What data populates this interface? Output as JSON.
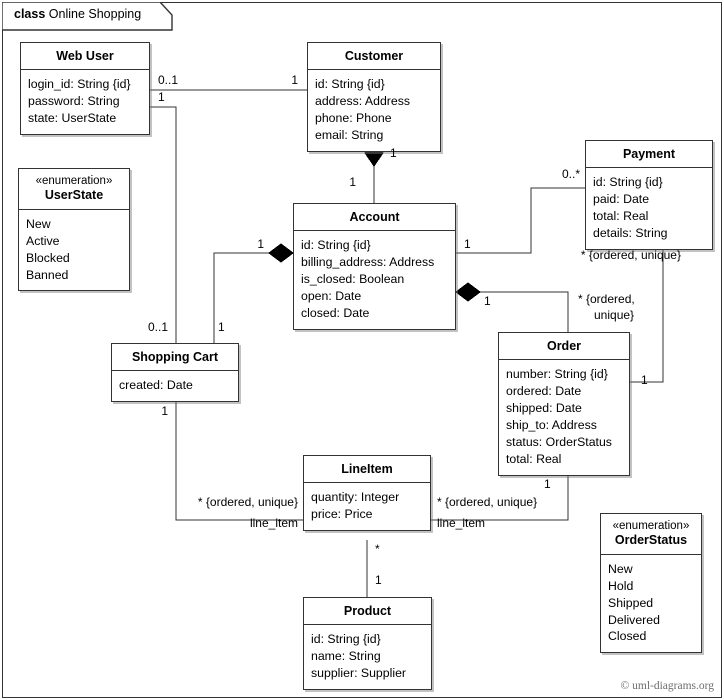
{
  "frame": {
    "keyword": "class",
    "name": "Online Shopping"
  },
  "credit": "© uml-diagrams.org",
  "classes": [
    {
      "id": "web-user",
      "name": "Web User",
      "attributes": [
        "login_id: String {id}",
        "password: String",
        "state: UserState"
      ]
    },
    {
      "id": "customer",
      "name": "Customer",
      "attributes": [
        "id: String {id}",
        "address: Address",
        "phone: Phone",
        "email: String"
      ]
    },
    {
      "id": "payment",
      "name": "Payment",
      "attributes": [
        "id: String {id}",
        "paid: Date",
        "total: Real",
        "details: String"
      ]
    },
    {
      "id": "user-state",
      "name": "UserState",
      "stereotype": "«enumeration»",
      "attributes": [
        "New",
        "Active",
        "Blocked",
        "Banned"
      ]
    },
    {
      "id": "account",
      "name": "Account",
      "attributes": [
        "id: String {id}",
        "billing_address: Address",
        "is_closed: Boolean",
        "open: Date",
        "closed: Date"
      ]
    },
    {
      "id": "shopping-cart",
      "name": "Shopping Cart",
      "attributes": [
        "created: Date"
      ]
    },
    {
      "id": "order",
      "name": "Order",
      "attributes": [
        "number: String {id}",
        "ordered: Date",
        "shipped: Date",
        "ship_to: Address",
        "status: OrderStatus",
        "total: Real"
      ]
    },
    {
      "id": "line-item",
      "name": "LineItem",
      "attributes": [
        "quantity: Integer",
        "price: Price"
      ]
    },
    {
      "id": "product",
      "name": "Product",
      "attributes": [
        "id: String {id}",
        "name: String",
        "supplier: Supplier"
      ]
    },
    {
      "id": "order-status",
      "name": "OrderStatus",
      "stereotype": "«enumeration»",
      "attributes": [
        "New",
        "Hold",
        "Shipped",
        "Delivered",
        "Closed"
      ]
    }
  ],
  "labels": {
    "webuser_customer_src": "0..1",
    "webuser_customer_tgt": "1",
    "webuser_cart_src": "1",
    "cart_webuser_end": "0..1",
    "customer_account_customer_end": "1",
    "customer_account_account_end": "1",
    "account_cart_account_end": "1",
    "account_cart_cart_end": "1",
    "account_payment_account_end": "1",
    "account_payment_payment_end": "0..*",
    "payment_ordered_unique": "* {ordered, unique}",
    "account_order_account_end": "1",
    "account_order_order_end_l1": "* {ordered,",
    "account_order_order_end_l2": "unique}",
    "order_payment_order_end": "1",
    "cart_lineitem_cart_end": "1",
    "cart_lineitem_item_end": "* {ordered, unique}",
    "cart_lineitem_role": "line_item",
    "order_lineitem_order_end": "1",
    "order_lineitem_item_end": "* {ordered, unique}",
    "order_lineitem_role": "line_item",
    "lineitem_product_item_end": "*",
    "lineitem_product_product_end": "1"
  },
  "colors": {
    "stroke": "#333333",
    "fill": "#ffffff",
    "text": "#000000",
    "credit": "#6e6e6e"
  }
}
